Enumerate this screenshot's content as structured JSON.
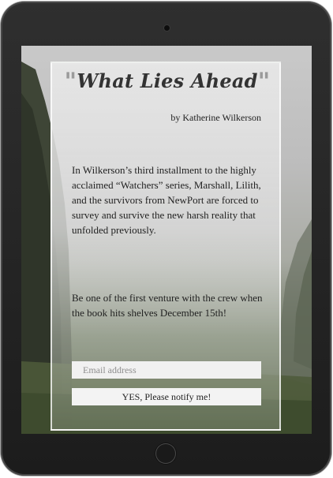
{
  "book": {
    "quote_open": "\"",
    "title": "What Lies Ahead",
    "quote_close": "\"",
    "author": "by Katherine Wilkerson"
  },
  "description": {
    "paragraph1": "In Wilkerson’s third installment to the highly acclaimed “Watchers” series, Marshall, Lilith, and the survivors from NewPort are forced to survey and survive the new harsh reality that unfolded previously.",
    "paragraph2": "Be one of the first venture with the crew when the book hits shelves December 15th!"
  },
  "signup": {
    "email_placeholder": "Email address",
    "button_label": "YES, Please notify me!"
  },
  "colors": {
    "tablet_frame": "#2a2a2a",
    "card_background": "#e2e2e2",
    "title_text": "#333333",
    "quote_marks": "#9a9a9a"
  }
}
